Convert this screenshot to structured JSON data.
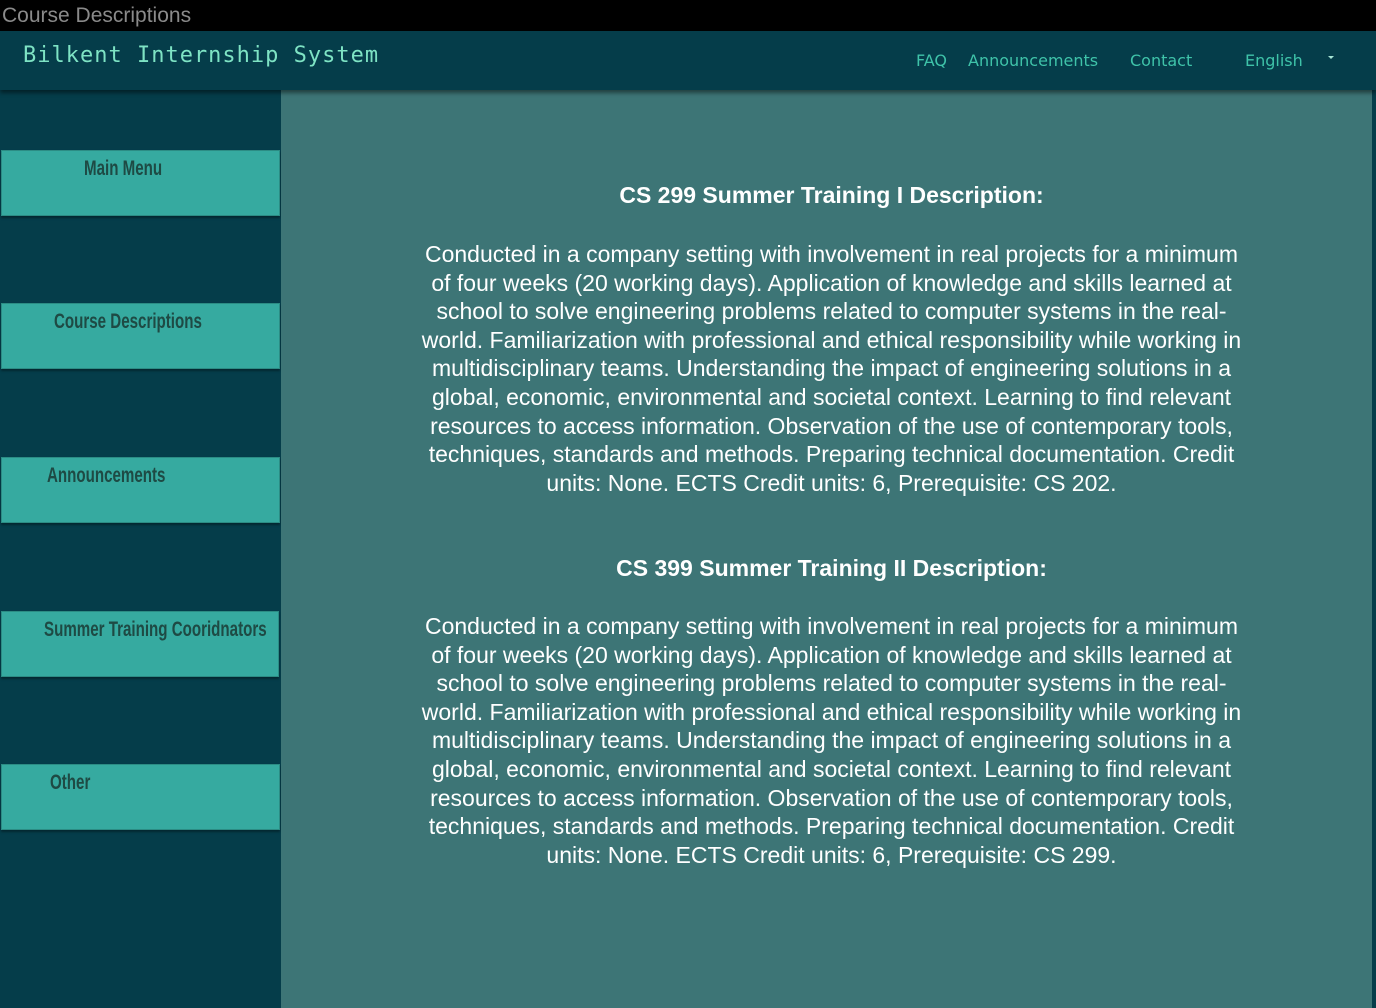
{
  "window": {
    "title": "Course Descriptions"
  },
  "header": {
    "brand": "Bilkent Internship System",
    "nav": {
      "faq": "FAQ",
      "announcements": "Announcements",
      "contact": "Contact",
      "language": "English"
    }
  },
  "sidebar": {
    "items": [
      {
        "label": "Main Menu"
      },
      {
        "label": "Course Descriptions"
      },
      {
        "label": "Announcements"
      },
      {
        "label": "Summer Training Cooridnators"
      },
      {
        "label": "Other"
      }
    ]
  },
  "main": {
    "sections": [
      {
        "heading": "CS 299 Summer Training I Description:",
        "body": "Conducted in a company setting with involvement in real projects for a minimum of four weeks (20 working days). Application of knowledge and skills learned at school to solve engineering problems related to computer systems in the real-world. Familiarization with professional and ethical responsibility while working in multidisciplinary teams. Understanding the impact of engineering solutions in a global, economic, environmental and societal context. Learning to find relevant resources to access information. Observation of the use of contemporary tools, techniques, standards and methods. Preparing technical documentation. Credit units: None. ECTS Credit units: 6, Prerequisite: CS 202."
      },
      {
        "heading": "CS 399 Summer Training II Description:",
        "body": "Conducted in a company setting with involvement in real projects for a minimum of four weeks (20 working days). Application of knowledge and skills learned at school to solve engineering problems related to computer systems in the real-world. Familiarization with professional and ethical responsibility while working in multidisciplinary teams. Understanding the impact of engineering solutions in a global, economic, environmental and societal context. Learning to find relevant resources to access information. Observation of the use of contemporary tools, techniques, standards and methods. Preparing technical documentation. Credit units: None. ECTS Credit units: 6, Prerequisite: CS 299."
      }
    ]
  },
  "colors": {
    "header_bg": "#053d4a",
    "sidebar_bg": "#053d4a",
    "sidebar_item_bg": "#36aaa0",
    "content_bg": "#3d7576",
    "brand_text": "#7ee3c4",
    "nav_text": "#3fc3a9"
  },
  "icons": {
    "language_dropdown": "caret-down-icon"
  }
}
